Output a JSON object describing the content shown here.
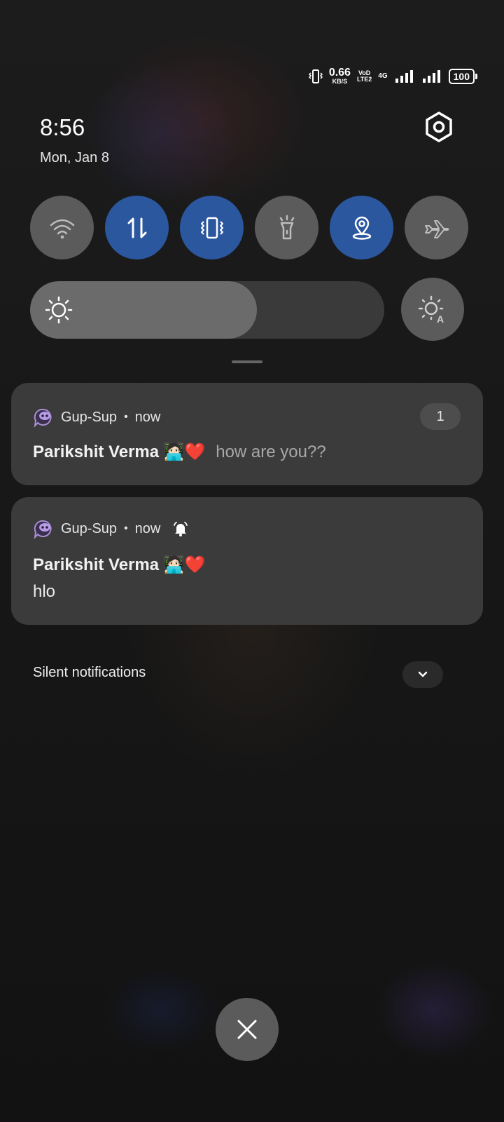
{
  "status_bar": {
    "net_speed": "0.66",
    "net_unit": "KB/S",
    "volte_top": "VoD",
    "volte_bottom": "LTE2",
    "network_type": "4G",
    "battery": "100"
  },
  "header": {
    "time": "8:56",
    "date": "Mon, Jan 8"
  },
  "quick_tiles": [
    {
      "name": "wifi",
      "active": false,
      "icon": "wifi-icon"
    },
    {
      "name": "mobile-data",
      "active": true,
      "icon": "data-arrows-icon"
    },
    {
      "name": "vibrate",
      "active": true,
      "icon": "vibrate-icon"
    },
    {
      "name": "flashlight",
      "active": false,
      "icon": "flashlight-icon"
    },
    {
      "name": "location",
      "active": true,
      "icon": "location-icon"
    },
    {
      "name": "airplane",
      "active": false,
      "icon": "airplane-icon"
    }
  ],
  "brightness": {
    "level": 0.64,
    "auto_icon": "auto-brightness-icon"
  },
  "notifications": [
    {
      "app": "Gup-Sup",
      "separator": "•",
      "time": "now",
      "count": "1",
      "sender": "Parikshit Verma",
      "emoji": "🧑🏻‍💻❤️",
      "message": "how are you??"
    },
    {
      "app": "Gup-Sup",
      "separator": "•",
      "time": "now",
      "sender": "Parikshit Verma",
      "emoji": "🧑🏻‍💻❤️",
      "message": "hlo"
    }
  ],
  "silent": {
    "label": "Silent notifications"
  },
  "colors": {
    "active_tile": "#2b579f",
    "inactive_tile": "#5b5b5b",
    "card": "#3b3b3b"
  }
}
